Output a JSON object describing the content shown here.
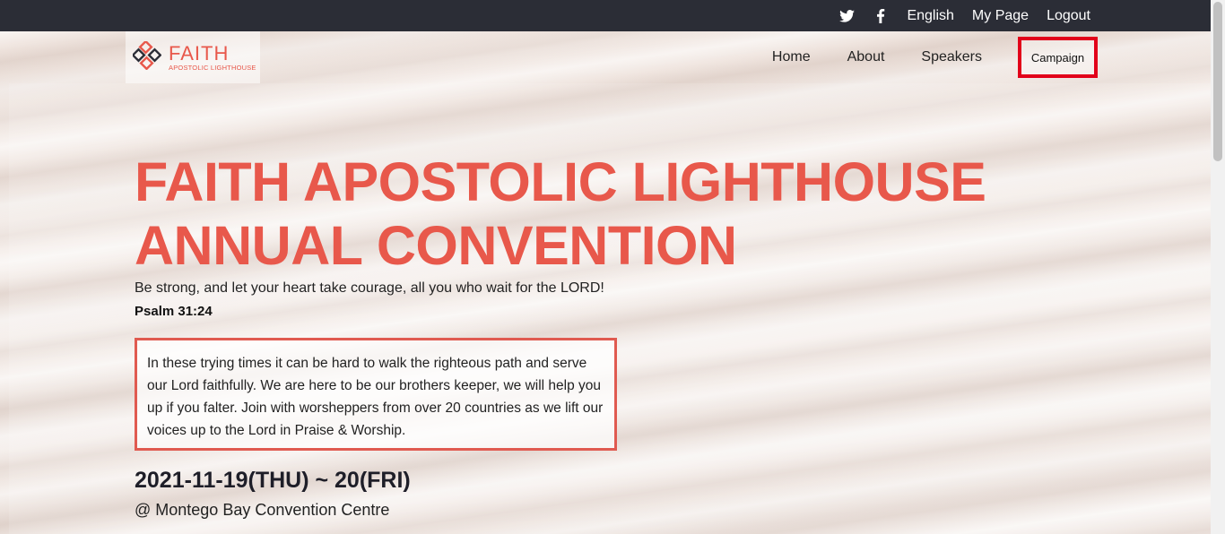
{
  "topbar": {
    "twitter_icon": "twitter-icon",
    "facebook_icon": "facebook-icon",
    "language": "English",
    "my_page": "My Page",
    "logout": "Logout"
  },
  "logo": {
    "title": "FAITH",
    "subtitle": "APOSTOLIC LIGHTHOUSE",
    "colors": {
      "accent": "#e8584b"
    }
  },
  "nav": {
    "items": [
      {
        "label": "Home"
      },
      {
        "label": "About"
      },
      {
        "label": "Speakers"
      },
      {
        "label": "Campaign"
      }
    ]
  },
  "hero": {
    "title_line1": "FAITH APOSTOLIC LIGHTHOUSE",
    "title_line2": "ANNUAL CONVENTION",
    "verse": "Be strong, and let your heart take courage, all you who wait for the LORD!",
    "reference": "Psalm 31:24",
    "description": "In these trying times it can be hard to walk the righteous path and serve our Lord faithfully. We are here to be our brothers keeper, we will help you up if you falter. Join with worsheppers from over 20 countries as we lift our voices up to the Lord in Praise & Worship.",
    "date": "2021-11-19(THU) ~ 20(FRI)",
    "venue": "@ Montego Bay Convention Centre"
  }
}
